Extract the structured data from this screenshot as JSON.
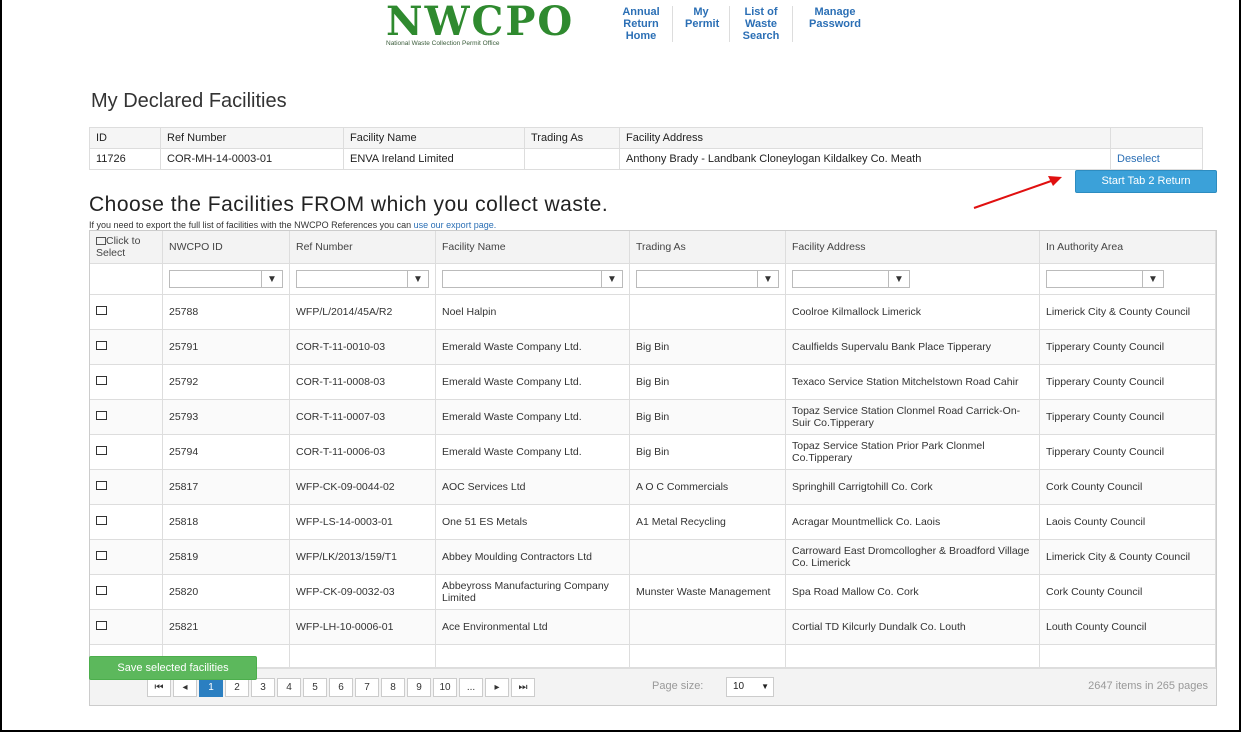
{
  "logo": {
    "text": "NWCPO",
    "subtitle": "National Waste Collection Permit Office"
  },
  "nav": [
    {
      "label": "Annual Return Home"
    },
    {
      "label": "My Permit"
    },
    {
      "label": "List of Waste Search"
    },
    {
      "label": "Manage Password"
    }
  ],
  "declared": {
    "title": "My Declared Facilities",
    "headers": [
      "ID",
      "Ref Number",
      "Facility Name",
      "Trading As",
      "Facility Address",
      ""
    ],
    "row": {
      "id": "11726",
      "ref": "COR-MH-14-0003-01",
      "name": "ENVA Ireland Limited",
      "trading": "",
      "address": "Anthony Brady - Landbank Cloneylogan Kildalkey Co. Meath",
      "action": "Deselect"
    },
    "start_button": "Start Tab 2 Return"
  },
  "choose": {
    "title": "Choose the Facilities FROM which you collect waste.",
    "note_prefix": "If you need to export the full list of facilities with the NWCPO References you can ",
    "note_link": "use our export page."
  },
  "grid": {
    "headers": {
      "select": "Click to Select",
      "id": "NWCPO ID",
      "ref": "Ref Number",
      "name": "Facility Name",
      "trading": "Trading As",
      "address": "Facility Address",
      "area": "In Authority Area"
    },
    "filter_icon": "funnel-icon",
    "rows": [
      {
        "id": "25788",
        "ref": "WFP/L/2014/45A/R2",
        "name": "Noel Halpin",
        "trading": "",
        "address": "Coolroe Kilmallock Limerick",
        "area": "Limerick City & County Council"
      },
      {
        "id": "25791",
        "ref": "COR-T-11-0010-03",
        "name": "Emerald Waste Company Ltd.",
        "trading": "Big Bin",
        "address": "Caulfields Supervalu Bank Place Tipperary",
        "area": "Tipperary County Council"
      },
      {
        "id": "25792",
        "ref": "COR-T-11-0008-03",
        "name": "Emerald Waste Company Ltd.",
        "trading": "Big Bin",
        "address": "Texaco Service Station Mitchelstown Road Cahir",
        "area": "Tipperary County Council"
      },
      {
        "id": "25793",
        "ref": "COR-T-11-0007-03",
        "name": "Emerald Waste Company Ltd.",
        "trading": "Big Bin",
        "address": "Topaz Service Station Clonmel Road Carrick-On-Suir Co.Tipperary",
        "area": "Tipperary County Council"
      },
      {
        "id": "25794",
        "ref": "COR-T-11-0006-03",
        "name": "Emerald Waste Company Ltd.",
        "trading": "Big Bin",
        "address": "Topaz Service Station Prior Park Clonmel Co.Tipperary",
        "area": "Tipperary County Council"
      },
      {
        "id": "25817",
        "ref": "WFP-CK-09-0044-02",
        "name": "AOC Services Ltd",
        "trading": "A O C Commercials",
        "address": "Springhill Carrigtohill Co. Cork",
        "area": "Cork County Council"
      },
      {
        "id": "25818",
        "ref": "WFP-LS-14-0003-01",
        "name": "One 51 ES Metals",
        "trading": "A1 Metal Recycling",
        "address": "Acragar Mountmellick Co. Laois",
        "area": "Laois County Council"
      },
      {
        "id": "25819",
        "ref": "WFP/LK/2013/159/T1",
        "name": "Abbey Moulding Contractors Ltd",
        "trading": "",
        "address": "Carroward East Dromcollogher & Broadford Village Co. Limerick",
        "area": "Limerick City & County Council"
      },
      {
        "id": "25820",
        "ref": "WFP-CK-09-0032-03",
        "name": "Abbeyross Manufacturing Company Limited",
        "trading": "Munster Waste Management",
        "address": "Spa Road Mallow Co. Cork",
        "area": "Cork County Council"
      },
      {
        "id": "25821",
        "ref": "WFP-LH-10-0006-01",
        "name": "Ace Environmental Ltd",
        "trading": "",
        "address": "Cortial TD Kilcurly Dundalk Co. Louth",
        "area": "Louth County Council"
      }
    ]
  },
  "pager": {
    "first": "⏮",
    "prev": "◂",
    "next": "▸",
    "last": "⏭",
    "pages": [
      "1",
      "2",
      "3",
      "4",
      "5",
      "6",
      "7",
      "8",
      "9",
      "10",
      "..."
    ],
    "active_page": "1",
    "page_size_label": "Page size:",
    "page_size": "10",
    "summary": "2647 items in 265 pages"
  },
  "save_button": "Save selected facilities",
  "colors": {
    "accent": "#2b7fc1",
    "start_btn": "#3ba1d9",
    "save_btn": "#5cb85c",
    "logo": "#2f8a2f",
    "arrow": "#e01010"
  }
}
